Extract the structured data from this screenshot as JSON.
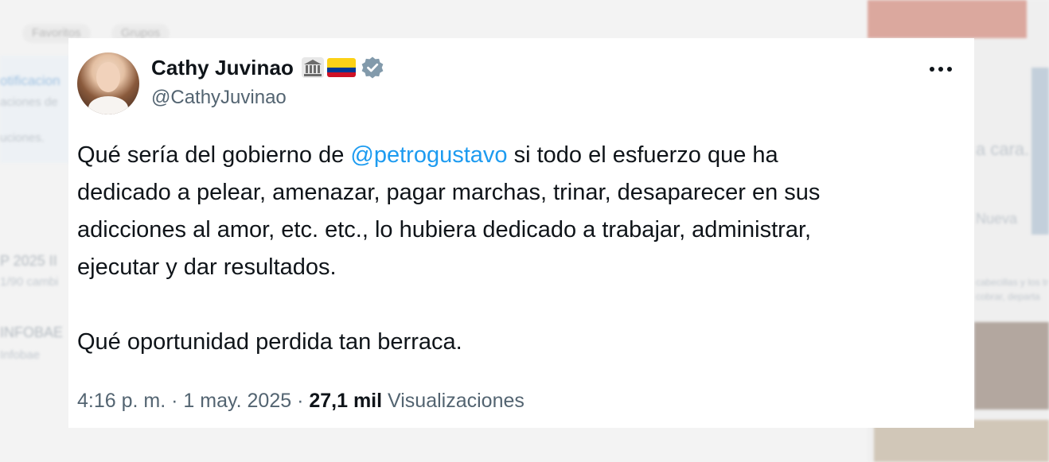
{
  "tweet": {
    "display_name": "Cathy Juvinao",
    "handle": "@CathyJuvinao",
    "badges": [
      "bank-icon",
      "colombia-flag-icon",
      "verified-badge-icon"
    ],
    "more_label": "•••",
    "text": {
      "line1_before": "Qué sería del gobierno de ",
      "mention": "@petrogustavo",
      "line1_after": " si todo el esfuerzo que ha",
      "line2": "dedicado a pelear, amenazar, pagar marchas, trinar, desaparecer en sus",
      "line3": "adicciones al amor, etc. etc., lo hubiera dedicado a trabajar, administrar,",
      "line4": "ejecutar y dar resultados.",
      "line5": "Qué oportunidad perdida tan berraca."
    },
    "meta": {
      "time": "4:16 p. m.",
      "sep1": " · ",
      "date": "1 may. 2025",
      "sep2": " · ",
      "views_count": "27,1 mil",
      "views_label": " Visualizaciones"
    }
  },
  "background": {
    "chips": [
      "Favoritos",
      "Grupos"
    ],
    "left_snippets": [
      "otificacion",
      "aciones de",
      "uciones.",
      "P 2025 II",
      "1/90 cambi",
      "INFOBAE",
      "Infobae"
    ],
    "right_snippets": [
      "a cara.",
      "Nueva",
      "cabecillas y los tra",
      "cobrar, departa"
    ]
  },
  "colors": {
    "text_primary": "#0f1419",
    "text_secondary": "#536471",
    "link": "#1d9bf0",
    "verified": "#829aab"
  }
}
